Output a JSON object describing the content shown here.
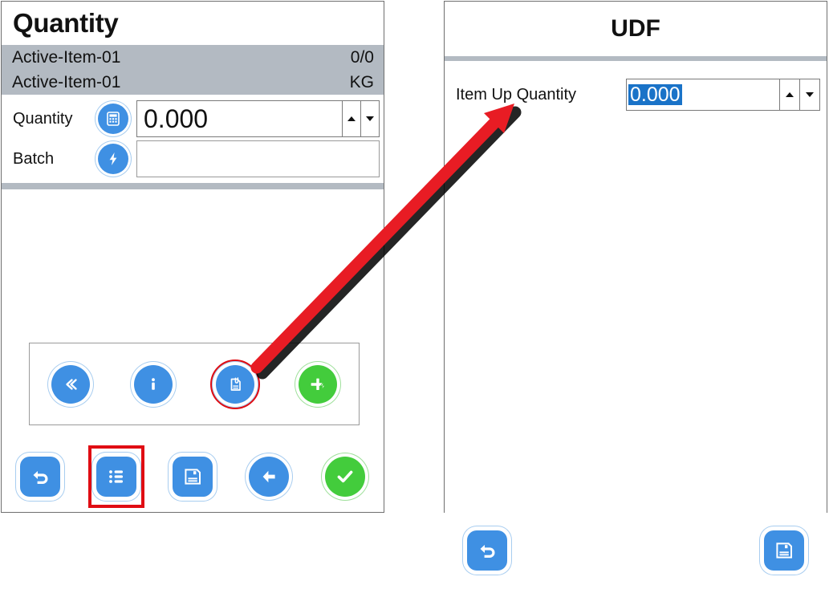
{
  "left_panel": {
    "title": "Quantity",
    "info": {
      "line1_left": "Active-Item-01",
      "line1_right": "0/0",
      "line2_left": "Active-Item-01",
      "line2_right": "KG"
    },
    "fields": [
      {
        "label": "Quantity",
        "icon": "calculator-icon",
        "value": "0.000",
        "has_spinner": true
      },
      {
        "label": "Batch",
        "icon": "lightning-bolt-icon",
        "value": "",
        "has_spinner": false
      }
    ],
    "icon_strip": [
      {
        "name": "collapse-double-left-icon",
        "color": "#3f90e3",
        "highlighted": false
      },
      {
        "name": "info-icon",
        "color": "#3f90e3",
        "highlighted": false
      },
      {
        "name": "document-attachment-icon",
        "color": "#3f90e3",
        "highlighted": true
      },
      {
        "name": "add-quick-icon",
        "color": "#43cc3c",
        "highlighted": false
      }
    ],
    "bottom_bar": [
      {
        "name": "undo-back-icon",
        "shape": "square",
        "color": "#3f90e3",
        "highlighted": false
      },
      {
        "name": "list-icon",
        "shape": "square",
        "color": "#3f90e3",
        "highlighted": true
      },
      {
        "name": "save-disk-icon",
        "shape": "square",
        "color": "#3f90e3",
        "highlighted": false
      },
      {
        "name": "arrow-left-icon",
        "shape": "circle",
        "color": "#3f90e3",
        "highlighted": false
      },
      {
        "name": "confirm-check-icon",
        "shape": "circle",
        "color": "#43cc3c",
        "highlighted": false
      }
    ]
  },
  "right_panel": {
    "title": "UDF",
    "field": {
      "label": "Item Up Quantity",
      "value": "0.000",
      "selected": true
    },
    "bottom_bar": [
      {
        "name": "undo-back-icon",
        "shape": "square",
        "color": "#3f90e3"
      },
      {
        "name": "save-disk-icon",
        "shape": "square",
        "color": "#3f90e3"
      }
    ]
  },
  "annotation": {
    "arrow_color": "#e81c24",
    "highlight_color": "#e00d13",
    "arrow_from": "document-attachment-icon",
    "arrow_to": "item-up-quantity-field"
  },
  "colors": {
    "accent_blue": "#3f90e3",
    "accent_green": "#43cc3c",
    "band_gray": "#b3bac2",
    "selection_blue": "#1a73c8",
    "annotation_red": "#e81c24"
  }
}
